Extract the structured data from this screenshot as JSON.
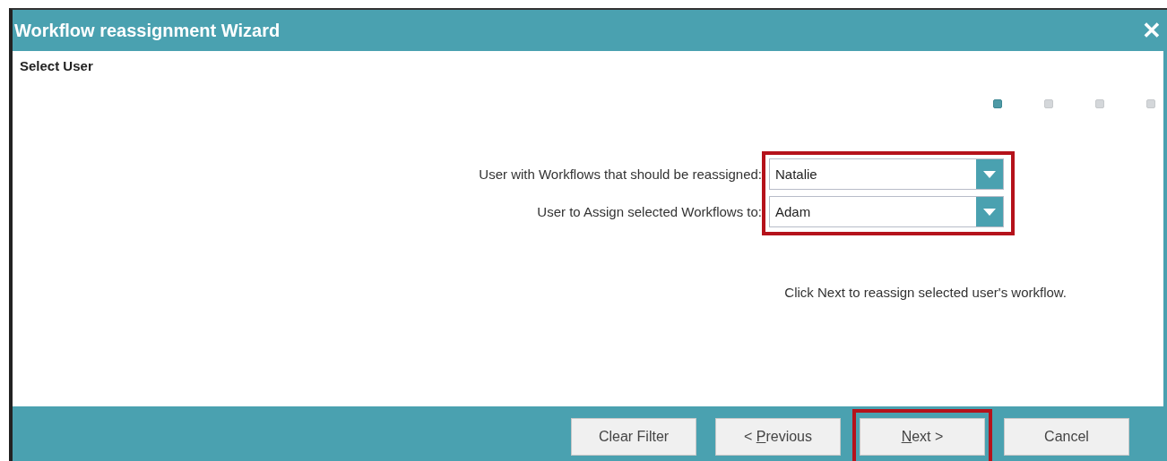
{
  "window": {
    "title": "Workflow reassignment Wizard",
    "close": "✕"
  },
  "page_title": "Select User",
  "steps": [
    {
      "selected": true
    },
    {
      "selected": false
    },
    {
      "selected": false
    },
    {
      "selected": false
    }
  ],
  "form": {
    "highlighted": true,
    "fields": [
      {
        "label": "User with Workflows that should be reassigned:",
        "value": "Natalie"
      },
      {
        "label": "User to Assign selected Workflows to:",
        "value": "Adam"
      }
    ]
  },
  "message": "Click Next to reassign selected user's workflow.",
  "buttons": [
    {
      "rest": "Clear Filter",
      "highlighted": false
    },
    {
      "prefix": "< ",
      "mnemonic": "P",
      "rest": "revious",
      "highlighted": false
    },
    {
      "mnemonic": "N",
      "rest": "ext >",
      "highlighted": true
    },
    {
      "rest": "Cancel",
      "highlighted": false
    }
  ]
}
